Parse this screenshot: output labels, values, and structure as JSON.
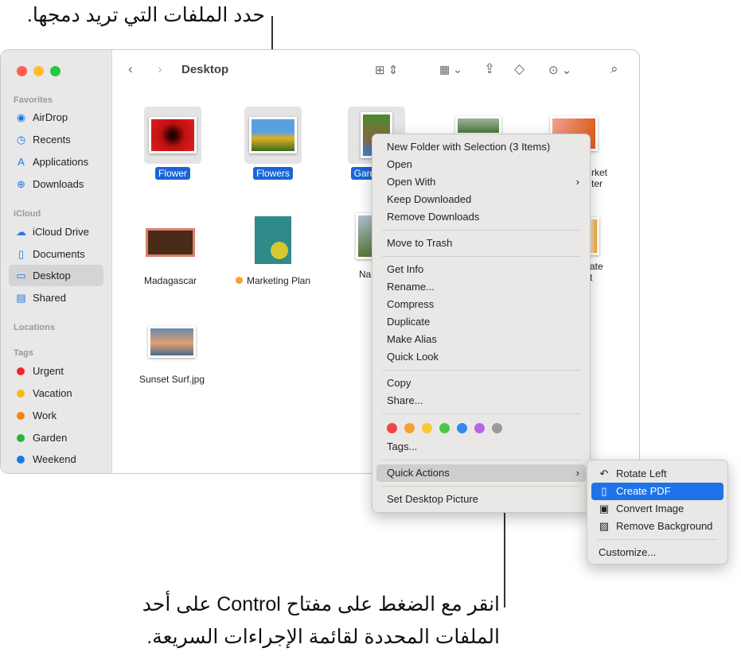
{
  "annotations": {
    "top": "حدد الملفات التي تريد دمجها.",
    "bottom_line1": "انقر مع الضغط على مفتاح Control على أحد",
    "bottom_line2": "الملفات المحددة لقائمة الإجراءات السريعة."
  },
  "window": {
    "title": "Desktop"
  },
  "sidebar": {
    "favorites_label": "Favorites",
    "favorites": [
      {
        "label": "AirDrop",
        "icon": "airdrop-icon"
      },
      {
        "label": "Recents",
        "icon": "clock-icon"
      },
      {
        "label": "Applications",
        "icon": "applications-icon"
      },
      {
        "label": "Downloads",
        "icon": "download-icon"
      }
    ],
    "icloud_label": "iCloud",
    "icloud": [
      {
        "label": "iCloud Drive",
        "icon": "cloud-icon"
      },
      {
        "label": "Documents",
        "icon": "document-icon"
      },
      {
        "label": "Desktop",
        "icon": "desktop-icon"
      },
      {
        "label": "Shared",
        "icon": "shared-folder-icon"
      }
    ],
    "locations_label": "Locations",
    "tags_label": "Tags",
    "tags": [
      {
        "label": "Urgent",
        "color": "#f0262b"
      },
      {
        "label": "Vacation",
        "color": "#f7bb0d"
      },
      {
        "label": "Work",
        "color": "#f7820d"
      },
      {
        "label": "Garden",
        "color": "#27b33b"
      },
      {
        "label": "Weekend",
        "color": "#1a7ae8"
      }
    ]
  },
  "files": [
    {
      "name": "Flower",
      "selected": true
    },
    {
      "name": "Flowers",
      "selected": true
    },
    {
      "name": "Garden",
      "selected": true,
      "visible": "Gard"
    },
    {
      "name": "",
      "partial": true
    },
    {
      "name": "rket",
      "line2": "ter"
    },
    {
      "name": "Madagascar"
    },
    {
      "name": "Marketing Plan",
      "tag_color": "#f7a030"
    },
    {
      "name": "Na"
    },
    {
      "name": "ate",
      "line2": "t"
    },
    {
      "name": "Sunset Surf.jpg"
    }
  ],
  "context_menu": {
    "items": [
      "New Folder with Selection (3 Items)",
      "Open",
      "Open With",
      "Keep Downloaded",
      "Remove Downloads",
      "Move to Trash",
      "Get Info",
      "Rename...",
      "Compress",
      "Duplicate",
      "Make Alias",
      "Quick Look",
      "Copy",
      "Share...",
      "Tags...",
      "Quick Actions",
      "Set Desktop Picture"
    ],
    "tag_colors": [
      "#f04545",
      "#f7a030",
      "#f7cb30",
      "#4cc74c",
      "#3a86f0",
      "#b866e0",
      "#9a9a9a"
    ],
    "submenu_arrow": "›"
  },
  "submenu": {
    "items": [
      {
        "label": "Rotate Left",
        "icon": "rotate-left-icon"
      },
      {
        "label": "Create PDF",
        "icon": "pdf-document-icon"
      },
      {
        "label": "Convert Image",
        "icon": "convert-image-icon"
      },
      {
        "label": "Remove Background",
        "icon": "remove-background-icon"
      }
    ],
    "customize": "Customize..."
  }
}
